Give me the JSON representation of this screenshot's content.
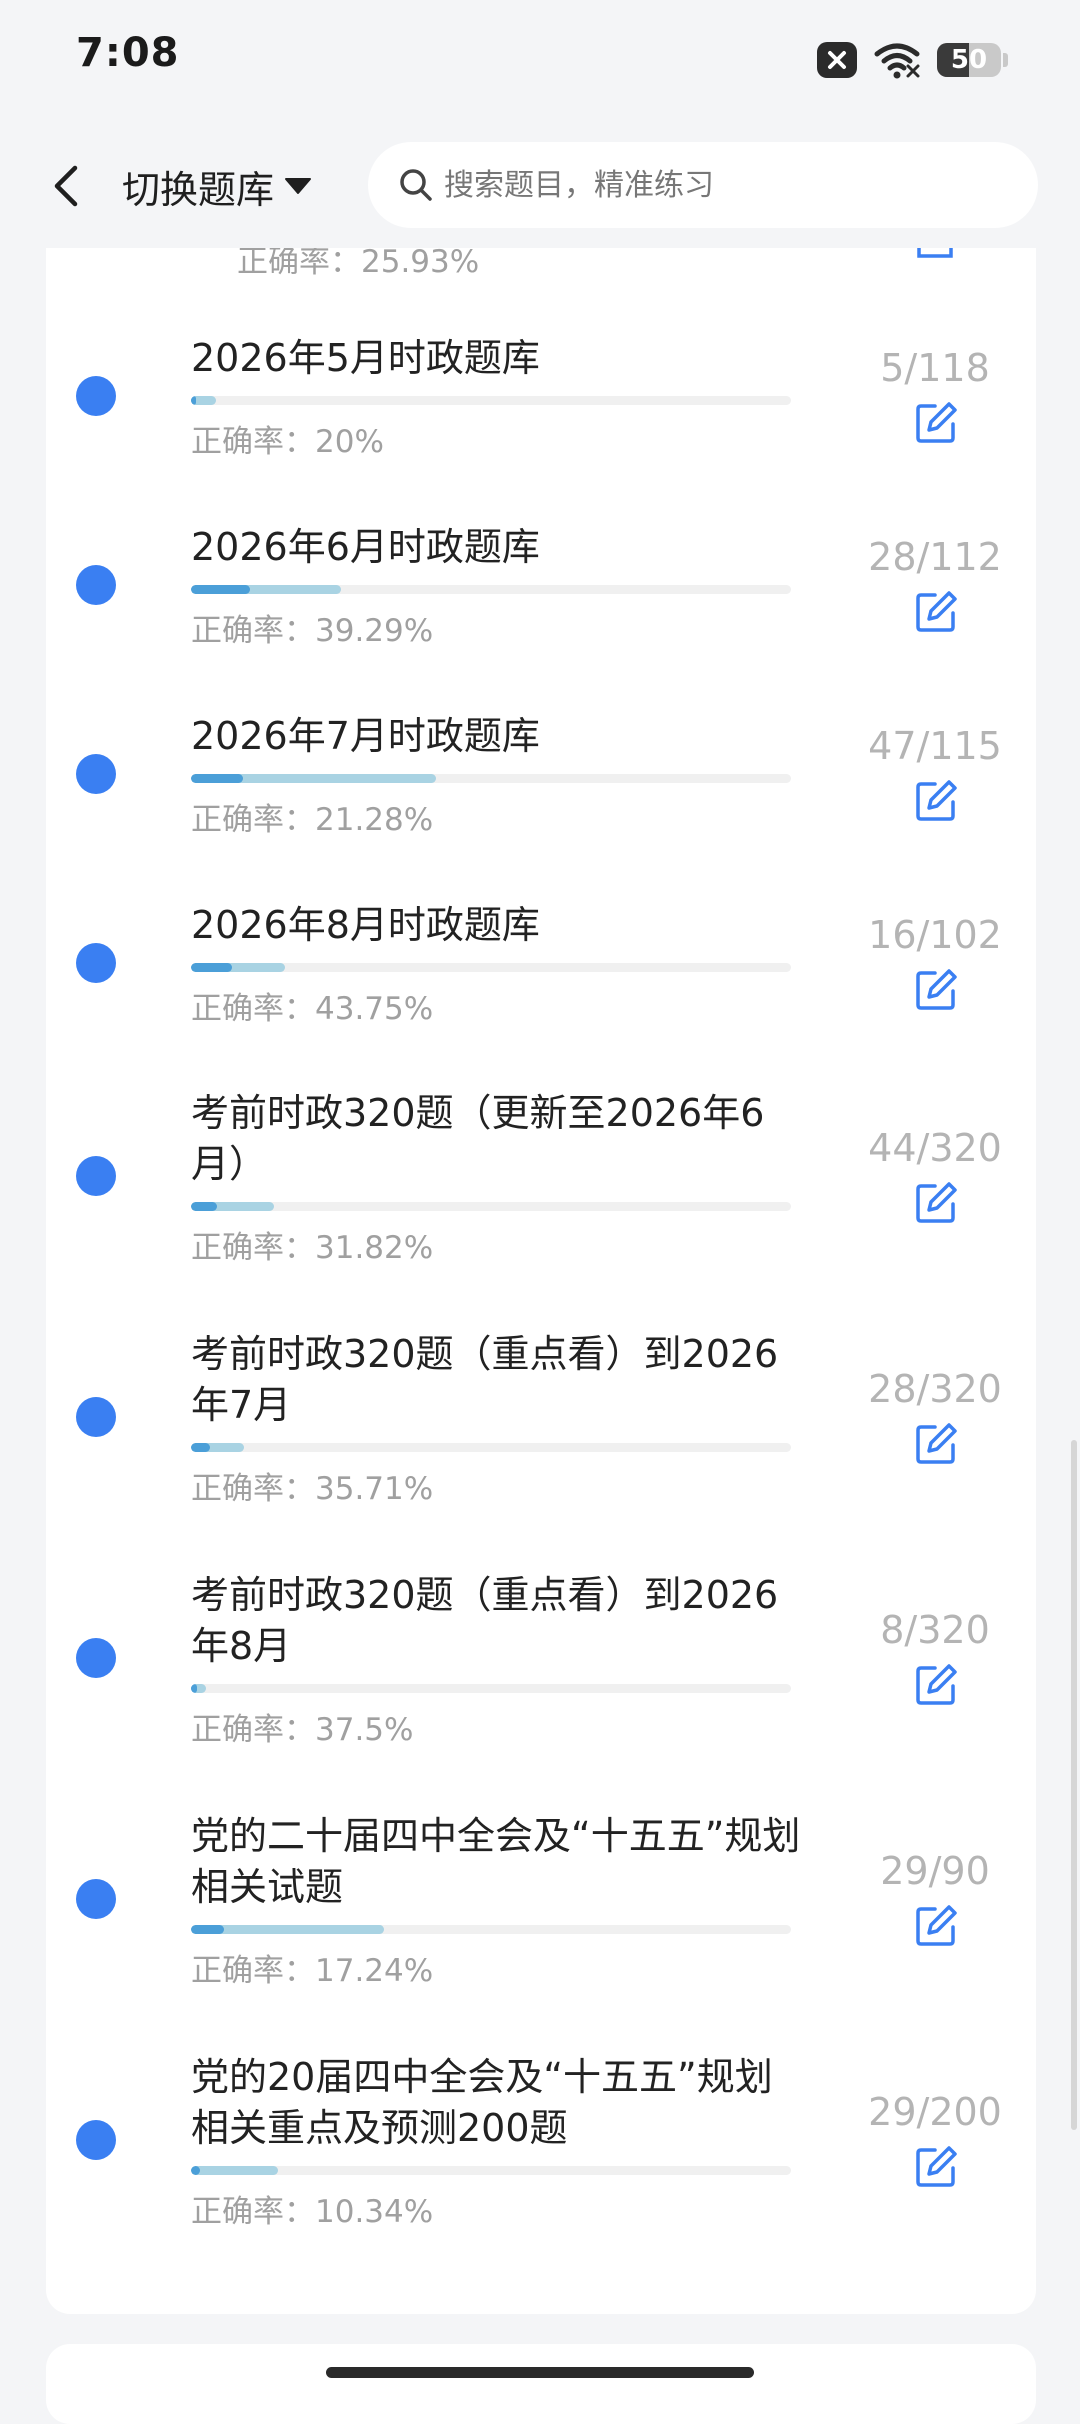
{
  "status_bar": {
    "time": "7:08",
    "battery": "50",
    "battery_level": 0.5,
    "icons": [
      "notification-x-icon",
      "wifi-icon",
      "battery-icon"
    ]
  },
  "header": {
    "back_icon": "chevron-left-icon",
    "switch_label": "切换题库",
    "switch_icon": "caret-down-icon",
    "search_placeholder": "搜索题目，精准练习",
    "search_icon": "search-icon"
  },
  "accent_color": "#3a7ff2",
  "partial_item": {
    "accuracy": "正确率：25.93%"
  },
  "items": [
    {
      "title": "2026年5月时政题库",
      "count": "5/118",
      "accuracy": "正确率：20%",
      "done_ratio": 0.042,
      "correct_ratio": 0.2
    },
    {
      "title": "2026年6月时政题库",
      "count": "28/112",
      "accuracy": "正确率：39.29%",
      "done_ratio": 0.25,
      "correct_ratio": 0.3929
    },
    {
      "title": "2026年7月时政题库",
      "count": "47/115",
      "accuracy": "正确率：21.28%",
      "done_ratio": 0.409,
      "correct_ratio": 0.2128
    },
    {
      "title": "2026年8月时政题库",
      "count": "16/102",
      "accuracy": "正确率：43.75%",
      "done_ratio": 0.157,
      "correct_ratio": 0.4375
    },
    {
      "title": "考前时政320题（更新至2026年6月）",
      "count": "44/320",
      "accuracy": "正确率：31.82%",
      "done_ratio": 0.1375,
      "correct_ratio": 0.3182
    },
    {
      "title": "考前时政320题（重点看）到2026年7月",
      "count": "28/320",
      "accuracy": "正确率：35.71%",
      "done_ratio": 0.0875,
      "correct_ratio": 0.3571
    },
    {
      "title": "考前时政320题（重点看）到2026年8月",
      "count": "8/320",
      "accuracy": "正确率：37.5%",
      "done_ratio": 0.025,
      "correct_ratio": 0.375
    },
    {
      "title": "党的二十届四中全会及“十五五”规划相关试题",
      "count": "29/90",
      "accuracy": "正确率：17.24%",
      "done_ratio": 0.322,
      "correct_ratio": 0.1724
    },
    {
      "title": "党的20届四中全会及“十五五”规划相关重点及预测200题",
      "count": "29/200",
      "accuracy": "正确率：10.34%",
      "done_ratio": 0.145,
      "correct_ratio": 0.1034
    }
  ]
}
